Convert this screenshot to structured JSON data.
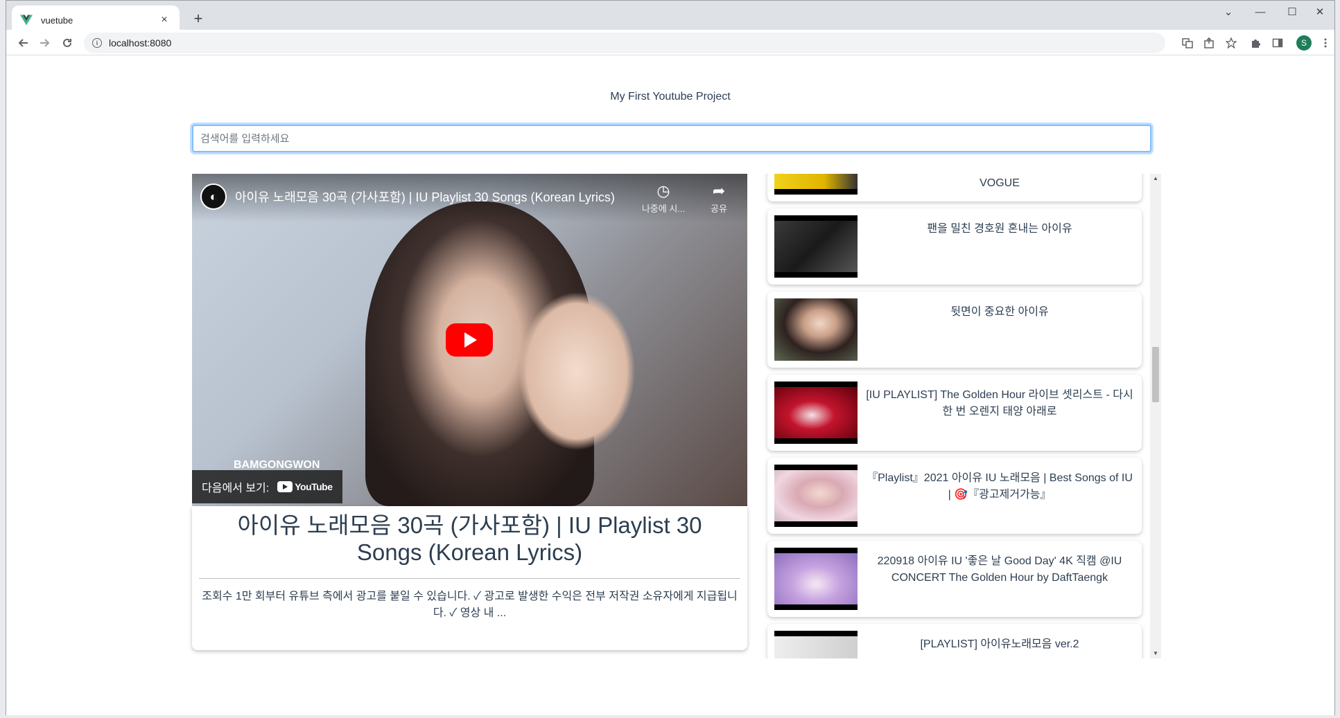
{
  "browser": {
    "tab_title": "vuetube",
    "tab_close": "×",
    "new_tab": "+",
    "url": "localhost:8080",
    "profile_initial": "S",
    "controls": {
      "minimize": "—",
      "maximize": "☐",
      "close": "✕",
      "tabs_menu": "⌄"
    }
  },
  "page": {
    "title": "My First Youtube Project",
    "search_placeholder": "검색어를 입력하세요"
  },
  "player": {
    "video_title": "아이유 노래모음 30곡 (가사포함) | IU Playlist 30 Songs (Korean Lyrics)",
    "watch_later": "나중에 시...",
    "share": "공유",
    "channel_name": "BAMGONGWON",
    "watch_on": "다음에서 보기:",
    "youtube_word": "YouTube"
  },
  "detail": {
    "title": "아이유 노래모음 30곡 (가사포함) | IU Playlist 30 Songs (Korean Lyrics)",
    "description": "조회수 1만 회부터 유튜브 측에서 광고를 붙일 수 있습니다. ✓ 광고로 발생한 수익은 전부 저작권 소유자에게 지급됩니다. ✓ 영상 내 ..."
  },
  "list": {
    "items": [
      {
        "title": "ㅎ ㅎ ㅎ ㅎ ㅎ ㅎ ㅎ ㅎ ㅎ ㅎ | ...\nVOGUE",
        "thumb_color": "#e8c51a"
      },
      {
        "title": "팬을 밀친 경호원 혼내는 아이유",
        "thumb_color": "#2b2b2b"
      },
      {
        "title": "뒷면이 중요한 아이유",
        "thumb_color": "#6b5446"
      },
      {
        "title": "[IU PLAYLIST] The Golden Hour 라이브 셋리스트 - 다시 한 번 오렌지 태양 아래로",
        "thumb_color": "#b3001b"
      },
      {
        "title": "『Playlist』2021 아이유 IU 노래모음 | Best Songs of IU | 🎯『광고제거가능』",
        "thumb_color": "#e9c6cf"
      },
      {
        "title": "220918 아이유 IU '좋은 날 Good Day' 4K 직캠 @IU CONCERT The Golden Hour by DaftTaengk",
        "thumb_color": "#b28fd3"
      },
      {
        "title": "[PLAYLIST] 아이유노래모음 ver.2",
        "thumb_color": "#d9d9d9"
      }
    ]
  }
}
